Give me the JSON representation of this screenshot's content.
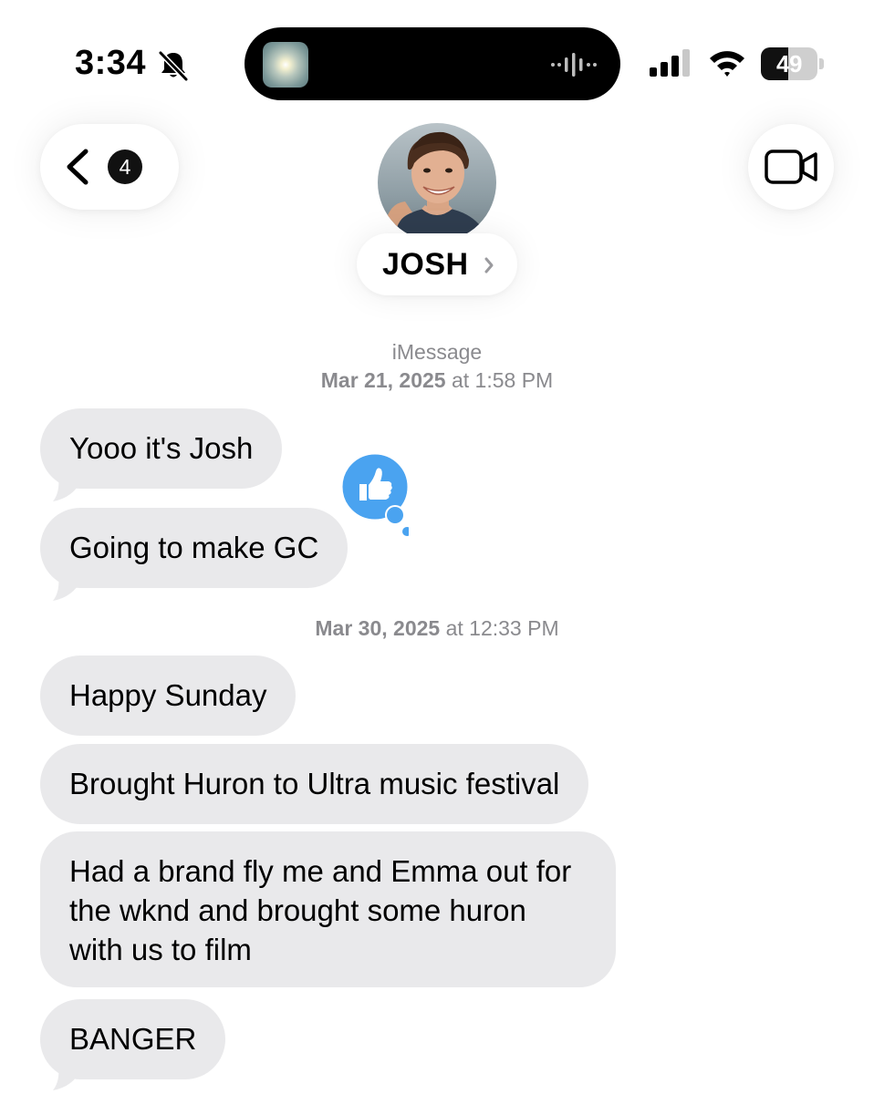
{
  "status_bar": {
    "time": "3:34",
    "battery_level": "49",
    "battery_fraction": 0.49,
    "icons": [
      "bell-slash-icon",
      "waveform-icon",
      "signal-icon",
      "wifi-icon",
      "battery-icon"
    ]
  },
  "header": {
    "unread_count": "4",
    "contact_name": "JOSH",
    "icons": [
      "chevron-left-icon",
      "video-camera-icon",
      "chevron-right-icon"
    ]
  },
  "thread": {
    "service_label": "iMessage",
    "timestamp_1": {
      "date": "Mar 21, 2025",
      "time": "at 1:58 PM"
    },
    "timestamp_2": {
      "date": "Mar 30, 2025",
      "time": "at 12:33 PM"
    },
    "messages": [
      {
        "text": "Yooo it's Josh"
      },
      {
        "text": "Going to make GC",
        "reaction": "thumbs-up"
      },
      {
        "text": "Happy Sunday"
      },
      {
        "text": "Brought Huron to Ultra music festival"
      },
      {
        "text": "Had a brand fly me and Emma out for the wknd and brought some huron with us to film"
      },
      {
        "text": "BANGER"
      }
    ]
  },
  "colors": {
    "incoming_bubble": "#e9e9eb",
    "tapback_blue": "#4aa3f0",
    "meta_text": "#8a8a8e"
  }
}
